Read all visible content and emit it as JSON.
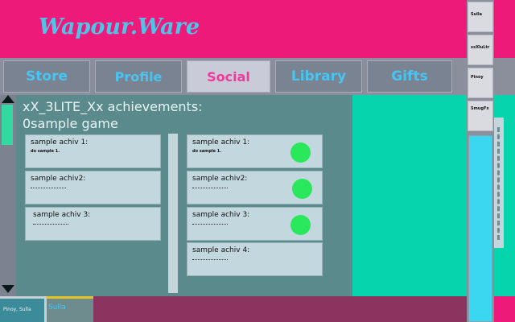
{
  "app": {
    "title": "Wapour.Ware"
  },
  "nav": {
    "tabs": [
      {
        "label": "Store"
      },
      {
        "label": "Profile"
      },
      {
        "label": "Social"
      },
      {
        "label": "Library"
      },
      {
        "label": "Gifts"
      }
    ],
    "active": "Social"
  },
  "achievements": {
    "title_line1": "xX_3LITE_Xx achievements:",
    "title_line2": "0sample game",
    "left_column": [
      {
        "name": "sample achiv 1:",
        "desc": "do sample 1."
      },
      {
        "name": "sample achiv2:",
        "desc": ""
      },
      {
        "name": "sample achiv 3:",
        "desc": ""
      }
    ],
    "right_column": [
      {
        "name": "sample achiv 1:",
        "desc": "do sample 1.",
        "completed": true
      },
      {
        "name": "sample achiv2:",
        "desc": "",
        "completed": true
      },
      {
        "name": "sample achiv 3:",
        "desc": "",
        "completed": true
      },
      {
        "name": "sample achiv 4:",
        "desc": "",
        "completed": false
      }
    ]
  },
  "friends": [
    "Sulla",
    "sxXluLtr",
    "Pinoy",
    "SmugFx"
  ],
  "chat_tabs": [
    {
      "label": "Pinoy, Sulla"
    },
    {
      "label": "Sulla"
    }
  ],
  "colors": {
    "brand_pink": "#ee1a7a",
    "accent_cyan": "#48c4f0",
    "active_tab_text": "#f03a9a",
    "complete_green": "#29e85c",
    "panel_teal": "#06d4ac"
  }
}
